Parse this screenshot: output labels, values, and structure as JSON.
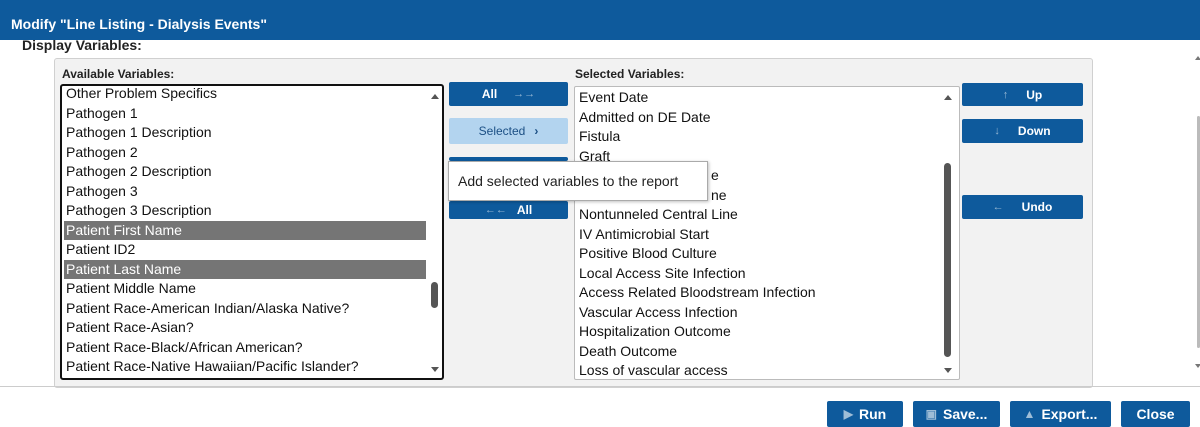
{
  "dialog": {
    "title": "Modify \"Line Listing - Dialysis Events\""
  },
  "section": {
    "heading": "Display Variables:"
  },
  "available": {
    "label": "Available Variables:",
    "items": [
      {
        "text": "Other Problem Specifics",
        "selected": false
      },
      {
        "text": "Pathogen 1",
        "selected": false
      },
      {
        "text": "Pathogen 1 Description",
        "selected": false
      },
      {
        "text": "Pathogen 2",
        "selected": false
      },
      {
        "text": "Pathogen 2 Description",
        "selected": false
      },
      {
        "text": "Pathogen 3",
        "selected": false
      },
      {
        "text": "Pathogen 3 Description",
        "selected": false
      },
      {
        "text": "Patient First Name",
        "selected": true
      },
      {
        "text": "Patient ID2",
        "selected": false
      },
      {
        "text": "Patient Last Name",
        "selected": true
      },
      {
        "text": "Patient Middle Name",
        "selected": false
      },
      {
        "text": "Patient Race-American Indian/Alaska Native?",
        "selected": false
      },
      {
        "text": "Patient Race-Asian?",
        "selected": false
      },
      {
        "text": "Patient Race-Black/African American?",
        "selected": false
      },
      {
        "text": "Patient Race-Native Hawaiian/Pacific Islander?",
        "selected": false
      }
    ]
  },
  "selected": {
    "label": "Selected Variables:",
    "items": [
      "Event Date",
      "Admitted on DE Date",
      "Fistula",
      "Graft",
      "",
      "",
      "Nontunneled Central Line",
      "IV Antimicrobial Start",
      "Positive Blood Culture",
      "Local Access Site Infection",
      "Access Related Bloodstream Infection",
      "Vascular Access Infection",
      "Hospitalization Outcome",
      "Death Outcome",
      "Loss of vascular access"
    ],
    "partial": [
      "e",
      "ne"
    ]
  },
  "transfer": {
    "add_all": "All",
    "add_selected": "Selected",
    "remove_all": "All"
  },
  "order": {
    "up": "Up",
    "down": "Down",
    "undo": "Undo"
  },
  "tooltip": {
    "text": "Add selected variables to the report"
  },
  "footer": {
    "run": "Run",
    "save": "Save...",
    "export": "Export...",
    "close": "Close"
  },
  "colors": {
    "primary": "#0e5a9c",
    "selected_row": "#757575",
    "selected_button": "#b3d4ef"
  }
}
